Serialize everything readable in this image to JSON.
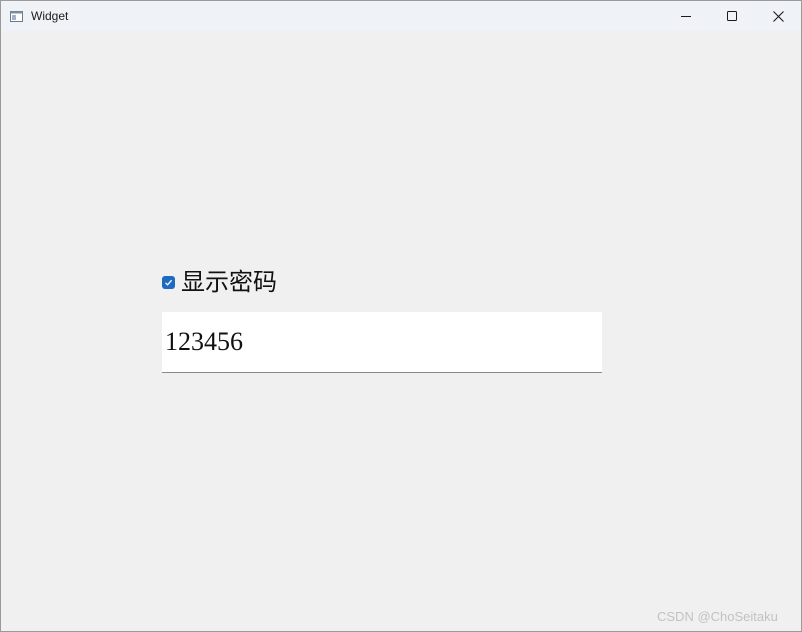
{
  "window": {
    "title": "Widget",
    "controls": {
      "minimize_icon": "minimize-icon",
      "maximize_icon": "maximize-icon",
      "close_icon": "close-icon"
    }
  },
  "form": {
    "show_password": {
      "label": "显示密码",
      "checked": true,
      "accent_color": "#1d6ac2"
    },
    "password_field": {
      "value": "123456"
    }
  },
  "watermark": {
    "text": "CSDN @ChoSeitaku"
  }
}
